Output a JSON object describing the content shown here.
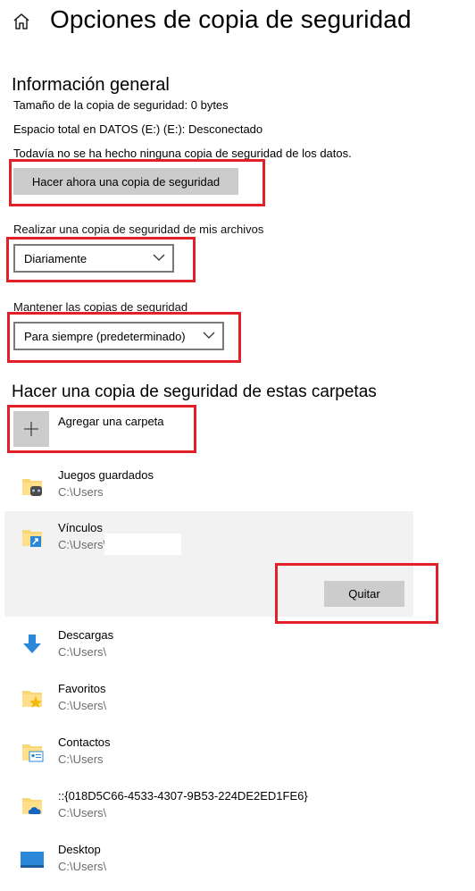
{
  "header": {
    "title": "Opciones de copia de seguridad",
    "home_icon": "home-icon"
  },
  "general": {
    "title": "Información general",
    "backup_size": "Tamaño de la copia de seguridad: 0 bytes",
    "total_space": "Espacio total en DATOS (E:) (E:): Desconectado",
    "no_backup": "Todavía no se ha hecho ninguna copia de seguridad de los datos.",
    "backup_now_label": "Hacer ahora una copia de seguridad"
  },
  "frequency": {
    "label": "Realizar una copia de seguridad de mis archivos",
    "selected": "Diariamente"
  },
  "retention": {
    "label": "Mantener las copias de seguridad",
    "selected": "Para siempre (predeterminado)"
  },
  "folders": {
    "title": "Hacer una copia de seguridad de estas carpetas",
    "add_label": "Agregar una carpeta",
    "remove_label": "Quitar",
    "items": [
      {
        "name": "Juegos guardados",
        "path": "C:\\Users",
        "icon": "saved-games-folder-icon"
      },
      {
        "name": "Vínculos",
        "path": "C:\\Users\\",
        "icon": "links-folder-icon"
      },
      {
        "name": "Descargas",
        "path": "C:\\Users\\",
        "icon": "downloads-icon"
      },
      {
        "name": "Favoritos",
        "path": "C:\\Users\\",
        "icon": "favorites-folder-icon"
      },
      {
        "name": "Contactos",
        "path": "C:\\Users",
        "icon": "contacts-folder-icon"
      },
      {
        "name": "::{018D5C66-4533-4307-9B53-224DE2ED1FE6}",
        "path": "C:\\Users\\",
        "icon": "onedrive-folder-icon"
      },
      {
        "name": "Desktop",
        "path": "C:\\Users\\",
        "icon": "desktop-icon"
      }
    ]
  },
  "colors": {
    "highlight": "#e1202a",
    "button": "#cccccc",
    "selected_row": "#f2f2f2",
    "accent": "#0078d7"
  }
}
